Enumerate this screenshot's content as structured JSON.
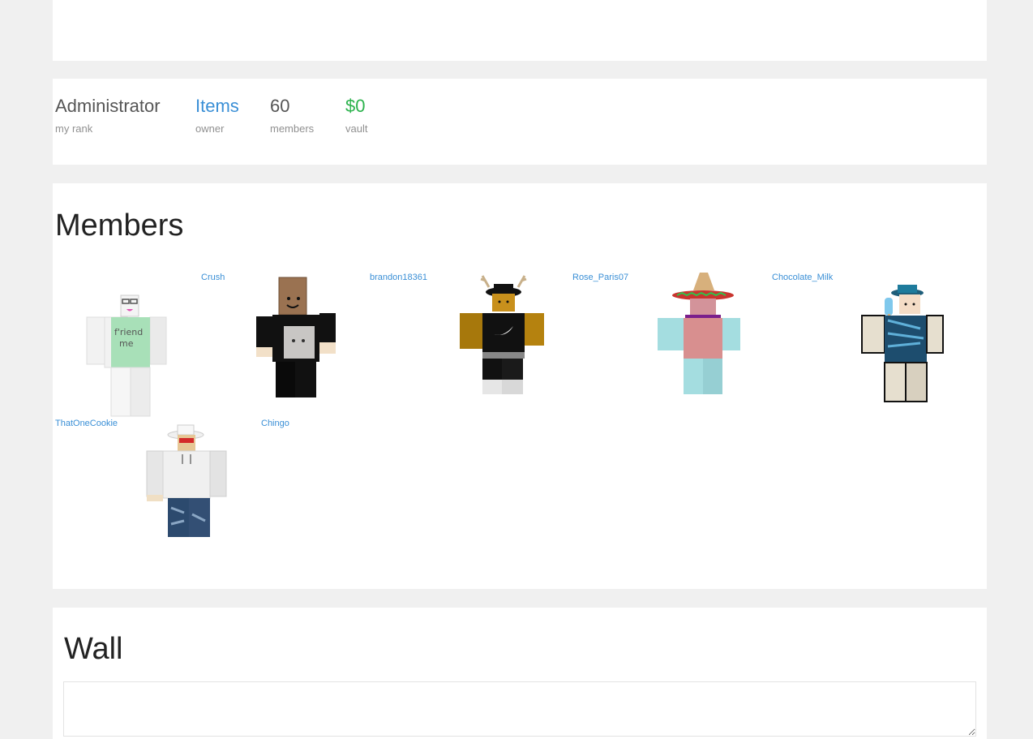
{
  "stats": [
    {
      "value": "Administrator",
      "label": "my rank"
    },
    {
      "value": "Items",
      "label": "owner"
    },
    {
      "value": "60",
      "label": "members"
    },
    {
      "value": "$0",
      "label": "vault"
    }
  ],
  "members": {
    "title": "Members",
    "list": [
      {
        "name": "Crush"
      },
      {
        "name": "brandon18361"
      },
      {
        "name": "Rose_Paris07"
      },
      {
        "name": "Chocolate_Milk"
      },
      {
        "name": "ThatOneCookie"
      },
      {
        "name": "Chingo"
      }
    ]
  },
  "wall": {
    "title": "Wall",
    "input_value": ""
  },
  "colors": {
    "link": "#3a8fd6",
    "money": "#2bb24c",
    "background": "#f0f0f0"
  }
}
